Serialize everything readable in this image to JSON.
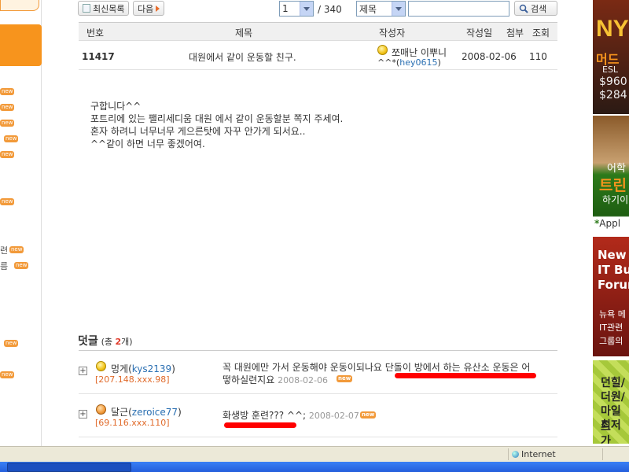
{
  "toolbar": {
    "latest_label": "최신목록",
    "next_label": "다음",
    "page_value": "1",
    "page_total": "/ 340",
    "search_field": "제목",
    "search_value": "",
    "search_label": "검색"
  },
  "table": {
    "headers": [
      "번호",
      "제목",
      "작성자",
      "작성일",
      "첨부",
      "조회"
    ],
    "row": {
      "num": "11417",
      "title": "대원에서 같이 운동할 친구.",
      "author_name": "쪼매난 이뿌니",
      "author_prefix": "^^*(",
      "author_id": "hey0615",
      "author_suffix": ")",
      "date": "2008-02-06",
      "views": "110"
    }
  },
  "post": {
    "lines": [
      "구합니다^^",
      "포트리에 있는 팰리세디움 대원 에서 같이 운동할분 쪽지 주세여.",
      "혼자 하려니 너무너무 게으른탓에 자꾸 안가게 되서요..",
      "^^같이 하면 너무 좋겠어여."
    ]
  },
  "comments_header": {
    "label": "덧글",
    "count_pre": "(총 ",
    "count": "2",
    "count_post": "개)"
  },
  "comments": [
    {
      "name": "멍게",
      "id_open": "(",
      "id": "kys2139",
      "id_close": ")",
      "ip": "[207.148.xxx.98]",
      "text_line1": "꼭 대원에만 가서 운동해야 운동이되나요 단돌이 방에서 하는 유산소 운동은 어",
      "text_line2": "떻하실련지요",
      "date": "2008-02-06"
    },
    {
      "name": "달근",
      "id_open": "(",
      "id": "zeroice77",
      "id_close": ")",
      "ip": "[69.116.xxx.110]",
      "text_line1": "화생방 훈련??? ^^;",
      "date": "2008-02-07"
    }
  ],
  "badges": {
    "new": "new"
  },
  "left_nav": [
    "련",
    "름"
  ],
  "ads": {
    "ad1": {
      "line1": "NY",
      "line2": "머드",
      "line3": "ESL",
      "line4": "$960",
      "line5": "$284"
    },
    "ad2": {
      "line1": "어학",
      "line2": "트린",
      "line3": "하기이",
      "line4": "Appl"
    },
    "ad3": {
      "line1": "New",
      "line2": "IT Bus",
      "line3": "Forun",
      "line4": "뉴욕 메",
      "line5": "IT관련",
      "line6": "그룹의"
    },
    "ad4": {
      "line1": "던힐/",
      "line2": "더원/",
      "line3": "마일드",
      "line4": "최저가"
    }
  },
  "statusbar": {
    "zone": "Internet"
  },
  "colors": {
    "accent": "#f7941d",
    "link": "#2a6fb2",
    "highlight": "#ff0000"
  }
}
